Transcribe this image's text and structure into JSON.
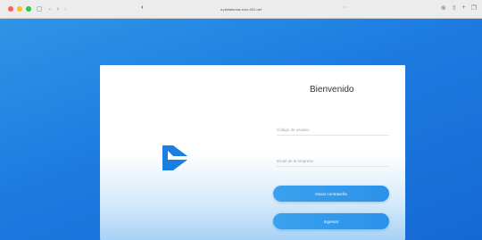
{
  "browser": {
    "url": "a.plataforma.xxxx-001.net",
    "traffic_light_colors": [
      "#ff5f57",
      "#febc2e",
      "#28c840"
    ],
    "icons": [
      "sidebar-icon",
      "chevron-down-icon",
      "back-icon",
      "forward-icon",
      "shield-icon",
      "more-icon",
      "download-icon",
      "share-icon",
      "new-tab-icon",
      "tabs-icon"
    ]
  },
  "login": {
    "title": "Bienvenido",
    "user_placeholder": "Código de usuario",
    "company_placeholder": "Email de la empresa",
    "primary_button": "Iniciar contraseña",
    "secondary_button": "Ingresar"
  },
  "colors": {
    "background_blue": "#1a73d8",
    "button_blue": "#2a92ea",
    "logo_blue": "#1a7fe0"
  }
}
